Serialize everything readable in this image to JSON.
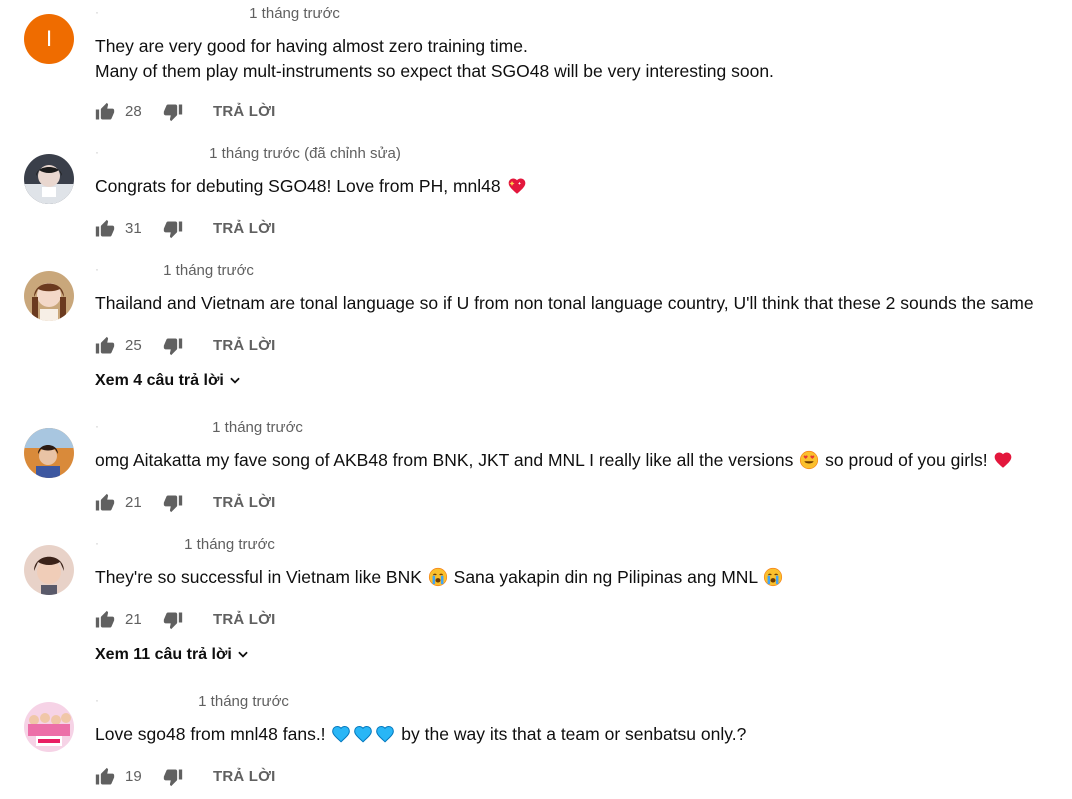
{
  "colors": {
    "text": "#0f0f0f",
    "secondary": "#606060",
    "avatar_letter_bg": "#ef6c00",
    "heart_red": "#e3173c",
    "heart_blue": "#29b6f6"
  },
  "reply_label": "TRẢ LỜI",
  "comments": [
    {
      "avatar_letter": "I",
      "time": "1 tháng trước",
      "lines": [
        "They are very good for having almost zero training time.",
        "Many of them play mult-instruments so expect that SGO48 will be very interesting soon."
      ],
      "likes": "28"
    },
    {
      "time": "1 tháng trước (đã chỉnh sửa)",
      "text": "Congrats for debuting SGO48! Love from PH, mnl48",
      "emoji": "sparkling-heart",
      "likes": "31"
    },
    {
      "time": "1 tháng trước",
      "text": "Thailand and Vietnam are tonal language so if U from non tonal language country, U'll think that these 2 sounds the same",
      "likes": "25",
      "view_replies": "Xem 4 câu trả lời"
    },
    {
      "time": "1 tháng trước",
      "text_a": "omg Aitakatta my fave song of AKB48 from BNK, JKT and MNL I really like all the versions",
      "text_b": "so proud of you girls!",
      "likes": "21"
    },
    {
      "time": "1 tháng trước",
      "text_a": "They're so successful in Vietnam like BNK",
      "text_b": "Sana yakapin din ng Pilipinas ang MNL",
      "likes": "21",
      "view_replies": "Xem 11 câu trả lời"
    },
    {
      "time": "1 tháng trước",
      "text_a": "Love sgo48 from mnl48 fans.!",
      "text_b": "by the way its that a team or senbatsu only.?",
      "likes": "19"
    }
  ]
}
